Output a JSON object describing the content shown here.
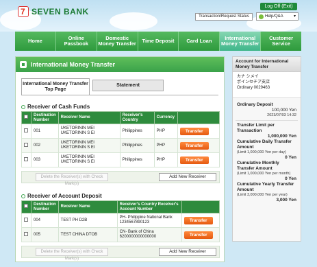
{
  "header": {
    "logo_text": "SEVEN BANK",
    "logo_mark": "7",
    "logoff": "Log Off (Exit)",
    "transaction_status": "Transaction/Request Status",
    "help": "Help/Q&A"
  },
  "nav": {
    "home": "Home",
    "online_passbook": "Online Passbook",
    "domestic_transfer": "Domestic Money Transfer",
    "time_deposit": "Time Deposit",
    "card_loan": "Card Loan",
    "international_transfer": "International Money Transfer",
    "customer_service": "Customer Service"
  },
  "page": {
    "title": "International Money Transfer",
    "tab_top": "International Money Transfer Top Page",
    "tab_statement": "Statement"
  },
  "cash": {
    "title": "Receiver of Cash Funds",
    "headers": [
      "Destination Number",
      "Receiver Name",
      "Receiver's Country",
      "Currency"
    ],
    "rows": [
      {
        "num": "001",
        "name": "UKETORININ MEI UKETORININ S EI",
        "country": "Philippines",
        "currency": "PHP",
        "btn": "Transfer"
      },
      {
        "num": "002",
        "name": "UKETORININ MEI UKETORININ S EI",
        "country": "Philippines",
        "currency": "PHP",
        "btn": "Transfer"
      },
      {
        "num": "003",
        "name": "UKETORININ MEI UKETORININ S EI",
        "country": "Philippines",
        "currency": "PHP",
        "btn": "Transfer"
      }
    ],
    "delete": "Delete the Receiver(s) with Check Mark(s)",
    "add": "Add New Receiver"
  },
  "account": {
    "title": "Receiver of Account Deposit",
    "headers": [
      "Destination Number",
      "Receiver Name",
      "Receiver's Country Receiver's Account Number"
    ],
    "rows": [
      {
        "num": "004",
        "name": "TEST PH D2B",
        "country_acct": "PH- Philippine National Bank 1234567890123",
        "btn": "Transfer"
      },
      {
        "num": "005",
        "name": "TEST CHINA DTOB",
        "country_acct": "CN- Bank of China 6200000000000000",
        "btn": "Transfer"
      }
    ],
    "delete": "Delete the Receiver(s) with Check Mark(s)",
    "add": "Add New Receiver"
  },
  "side": {
    "title": "Account for International Money Transfer",
    "kana": "カナ シメイ",
    "branch": "ポインセチア支店",
    "ordinary": "Ordinary 0029463",
    "deposit_label": "Ordinary Deposit",
    "deposit_value": "100,000 Yen",
    "deposit_date": "2023/07/03 14:32",
    "limit_label": "Transfer Limit per Transaction",
    "limit_value": "1,000,000 Yen",
    "daily_label": "Cumulative Daily Transfer Amount",
    "daily_note": "(Limit 1,000,000 Yen per day)",
    "daily_value": "0 Yen",
    "monthly_label": "Cumulative Monthly Transfer Amount",
    "monthly_note": "(Limit 1,000,000 Yen per month)",
    "monthly_value": "0 Yen",
    "yearly_label": "Cumulative Yearly Transfer Amount",
    "yearly_note": "(Limit 3,000,000 Yen per year)",
    "yearly_value": "3,000 Yen"
  }
}
